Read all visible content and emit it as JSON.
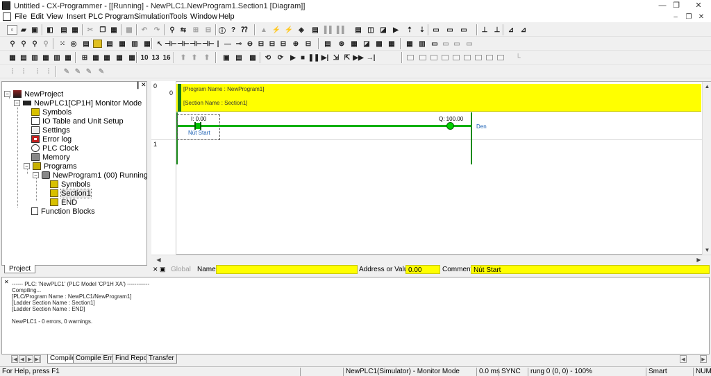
{
  "window": {
    "title": "Untitled - CX-Programmer - [[Running] - NewPLC1.NewProgram1.Section1 [Diagram]]",
    "minimize": "—",
    "restore": "❐",
    "close": "✕"
  },
  "menu": {
    "items": [
      "File",
      "Edit",
      "View",
      "Insert",
      "PLC",
      "Program",
      "Simulation",
      "Tools",
      "Window",
      "Help"
    ],
    "mdi_min": "–",
    "mdi_restore": "❐",
    "mdi_close": "✕"
  },
  "project": {
    "tab_label": "Project",
    "tree": {
      "root": "NewProject",
      "plc": "NewPLC1[CP1H] Monitor Mode",
      "symbols": "Symbols",
      "io_table": "IO Table and Unit Setup",
      "settings": "Settings",
      "error_log": "Error log",
      "plc_clock": "PLC Clock",
      "memory": "Memory",
      "programs": "Programs",
      "program": "NewProgram1 (00) Running",
      "program_symbols": "Symbols",
      "section": "Section1",
      "end": "END",
      "function_blocks": "Function Blocks"
    }
  },
  "diagram": {
    "rung0_number": "0",
    "rung0_step": "0",
    "rung1_number": "1",
    "program_name": "[Program Name : NewProgram1]",
    "section_name": "[Section Name : Section1]",
    "contact_address": "I: 0.00",
    "contact_comment": "Nút Start",
    "coil_address": "Q: 100.00",
    "coil_comment": "Den"
  },
  "infobar": {
    "global_label": "Global",
    "name_label": "Name:",
    "name_value": "",
    "address_label": "Address or Value:",
    "address_value": "0.00",
    "comment_label": "Comment:",
    "comment_value": "Nút Start"
  },
  "output": {
    "lines": [
      "------ PLC: 'NewPLC1' (PLC Model 'CP1H XA') ------------",
      "Compiling...",
      "[PLC/Program Name : NewPLC1/NewProgram1]",
      "[Ladder Section Name : Section1]",
      "[Ladder Section Name : END]",
      "",
      "NewPLC1 - 0 errors, 0 warnings."
    ],
    "tabs": [
      "Compile",
      "Compile Error",
      "Find Report",
      "Transfer"
    ]
  },
  "status": {
    "help": "For Help, press F1",
    "plc_mode": "NewPLC1(Simulator) - Monitor Mode",
    "cycle": "0.0 ms",
    "sync": "SYNC",
    "position": "rung 0 (0, 0)  - 100%",
    "smart": "Smart",
    "num": "NUM"
  },
  "colors": {
    "rung_highlight": "#ffff00",
    "power_flow": "#00b000",
    "rail": "#1a8a1a",
    "comment_text": "#1a5fb4"
  }
}
